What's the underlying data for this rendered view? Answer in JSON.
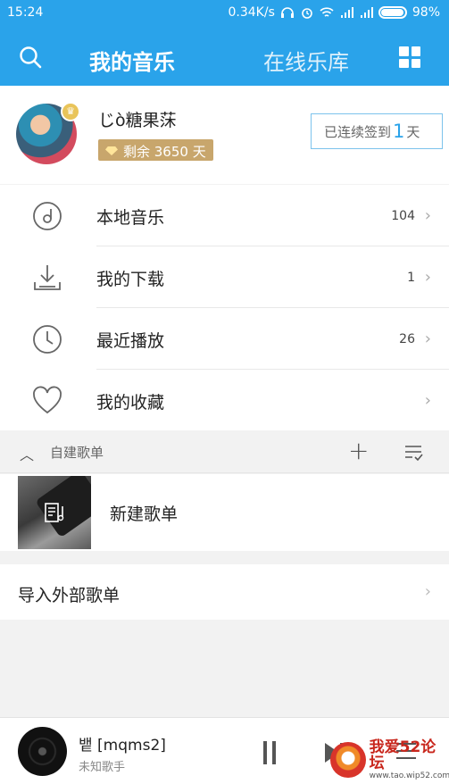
{
  "status_bar": {
    "time": "15:24",
    "network_speed": "0.34K/s",
    "battery": "98%"
  },
  "app_bar": {
    "tabs": [
      "我的音乐",
      "在线乐库"
    ],
    "search_icon": "search-icon",
    "grid_icon": "grid-menu-icon"
  },
  "profile": {
    "username": "じò糖果莯",
    "vip_text": "剩余 3650 天",
    "signin_prefix": "已连续签到",
    "signin_days": "1",
    "signin_suffix": "天"
  },
  "menu": [
    {
      "label": "本地音乐",
      "count": "104",
      "icon": "disc-icon"
    },
    {
      "label": "我的下载",
      "count": "1",
      "icon": "download-icon"
    },
    {
      "label": "最近播放",
      "count": "26",
      "icon": "clock-icon"
    },
    {
      "label": "我的收藏",
      "count": "",
      "icon": "heart-icon"
    }
  ],
  "section": {
    "title": "自建歌单",
    "add": "+"
  },
  "playlists": [
    {
      "name": "新建歌单"
    }
  ],
  "import": {
    "label": "导入外部歌单"
  },
  "player": {
    "song": "뱉 [mqms2]",
    "artist": "未知歌手"
  },
  "watermark": {
    "brand": "我爱52论坛",
    "url": "www.tao.wip52.com"
  },
  "colors": {
    "accent": "#2aa3ea",
    "vip_gold": "#c8a66c"
  }
}
